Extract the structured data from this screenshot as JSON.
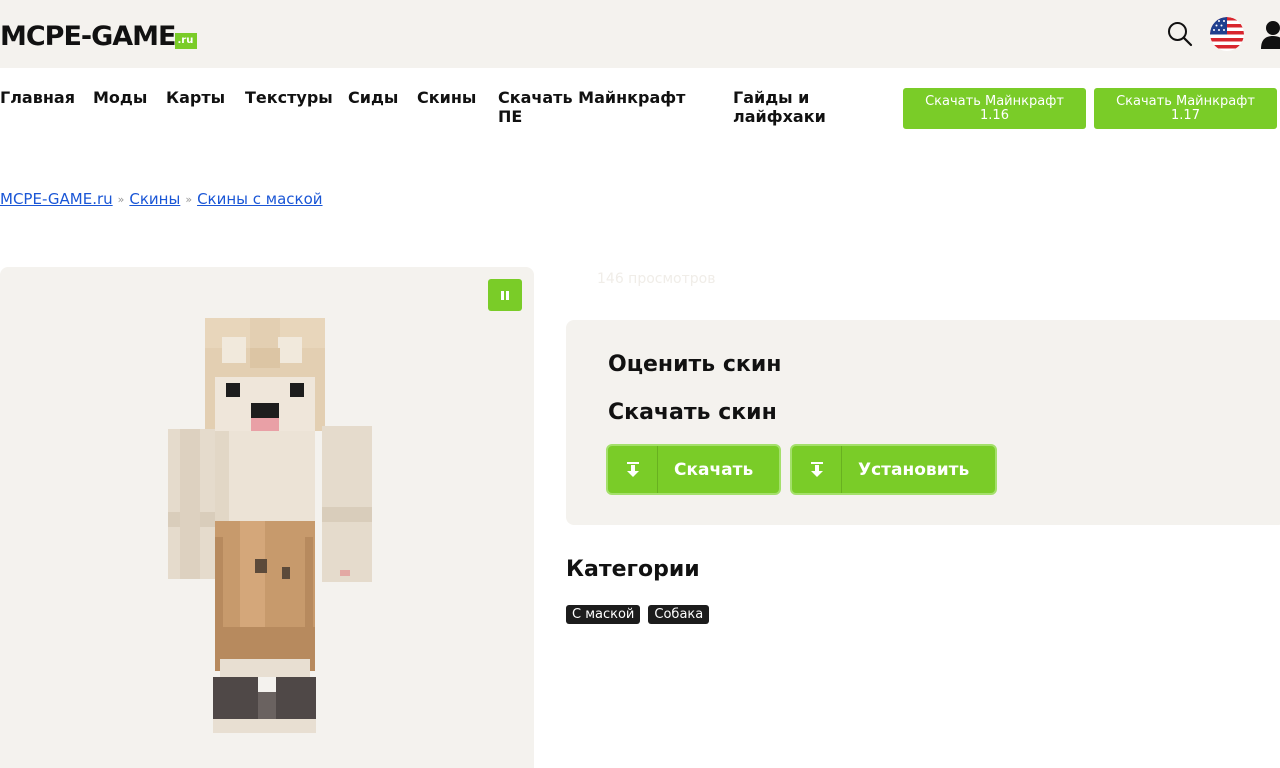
{
  "header": {
    "logo_main": "MCPE-GAME",
    "logo_suffix": ".ru"
  },
  "nav": {
    "items": [
      "Главная",
      "Моды",
      "Карты",
      "Текстуры",
      "Сиды",
      "Скины",
      "Скачать Майнкрафт ПЕ",
      "Гайды и лайфхаки"
    ]
  },
  "download_buttons": [
    {
      "line1": "Скачать Майнкрафт",
      "line2": "1.16"
    },
    {
      "line1": "Скачать Майнкрафт",
      "line2": "1.17"
    }
  ],
  "breadcrumb": {
    "items": [
      "MCPE-GAME.ru",
      "Скины",
      "Скины с маской"
    ],
    "separator": "»"
  },
  "skin": {
    "views": "146 просмотров"
  },
  "actions": {
    "rate_title": "Оценить скин",
    "download_title": "Скачать скин",
    "download_label": "Скачать",
    "install_label": "Установить"
  },
  "categories": {
    "title": "Категории",
    "tags": [
      "С маской",
      "Собака"
    ]
  },
  "colors": {
    "accent": "#7acc28",
    "panel": "#f4f2ee",
    "link": "#1a56d6",
    "tag_bg": "#1c1c1c"
  },
  "icons": {
    "search": "search-icon",
    "language": "us-flag-icon",
    "account": "user-icon",
    "pause": "pause-icon",
    "download": "download-arrow-icon"
  }
}
